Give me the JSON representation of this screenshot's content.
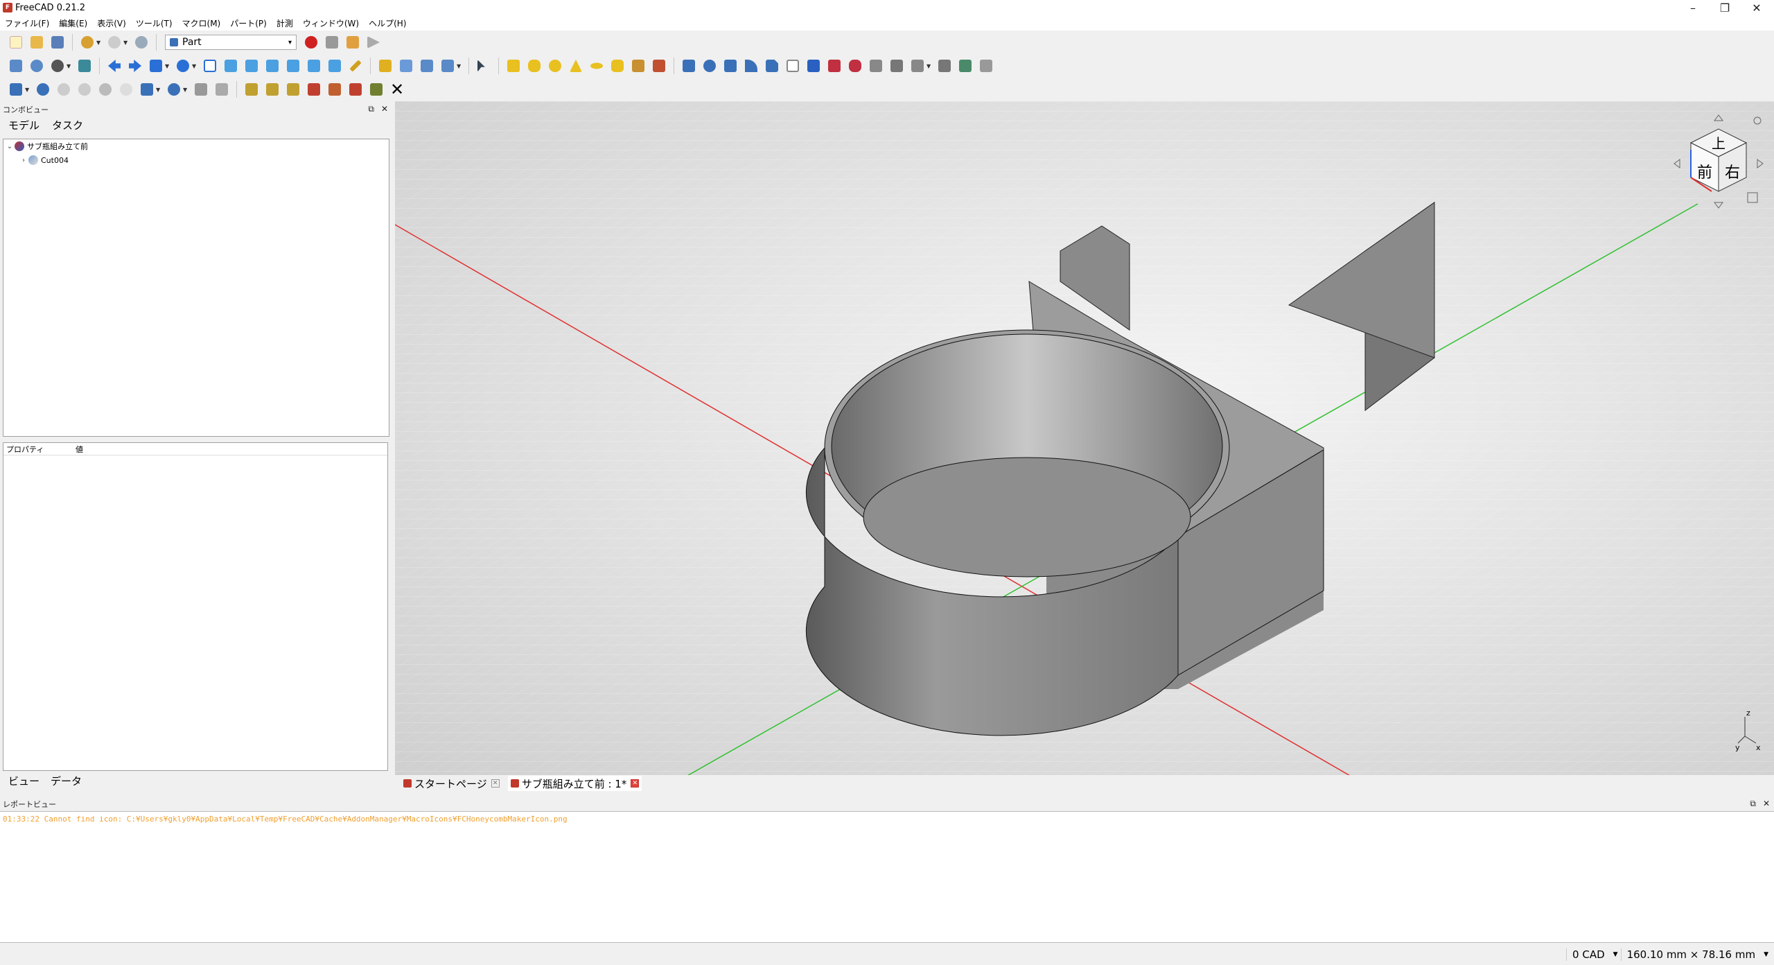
{
  "window": {
    "title": "FreeCAD 0.21.2"
  },
  "menu": [
    "ファイル(F)",
    "編集(E)",
    "表示(V)",
    "ツール(T)",
    "マクロ(M)",
    "パート(P)",
    "計測",
    "ウィンドウ(W)",
    "ヘルプ(H)"
  ],
  "workbench": {
    "selected": "Part"
  },
  "combo_view": {
    "title": "コンボビュー",
    "tabs": [
      "モデル",
      "タスク"
    ],
    "tree": {
      "root": "サブ瓶組み立て前",
      "child": "Cut004"
    },
    "properties": {
      "col_property": "プロパティ",
      "col_value": "値"
    },
    "bottom_tabs": [
      "ビュー",
      "データ"
    ]
  },
  "nav_cube": {
    "top": "上",
    "front": "前",
    "right": "右"
  },
  "axis_labels": {
    "z": "z",
    "y": "y",
    "x": "x"
  },
  "doc_tabs": [
    {
      "label": "スタートページ",
      "active": false
    },
    {
      "label": "サブ瓶組み立て前 : 1*",
      "active": true
    }
  ],
  "report_view": {
    "title": "レポートビュー",
    "message": "01:33:22  Cannot find icon: C:¥Users¥gkly0¥AppData¥Local¥Temp¥FreeCAD¥Cache¥AddonManager¥MacroIcons¥FCHoneycombMakerIcon.png"
  },
  "status": {
    "units": "0 CAD",
    "dimensions": "160.10 mm × 78.16 mm"
  },
  "colors": {
    "x_axis": "#e03030",
    "y_axis": "#30c030",
    "model": "#8c8c8c",
    "brand": "#c0392b"
  }
}
